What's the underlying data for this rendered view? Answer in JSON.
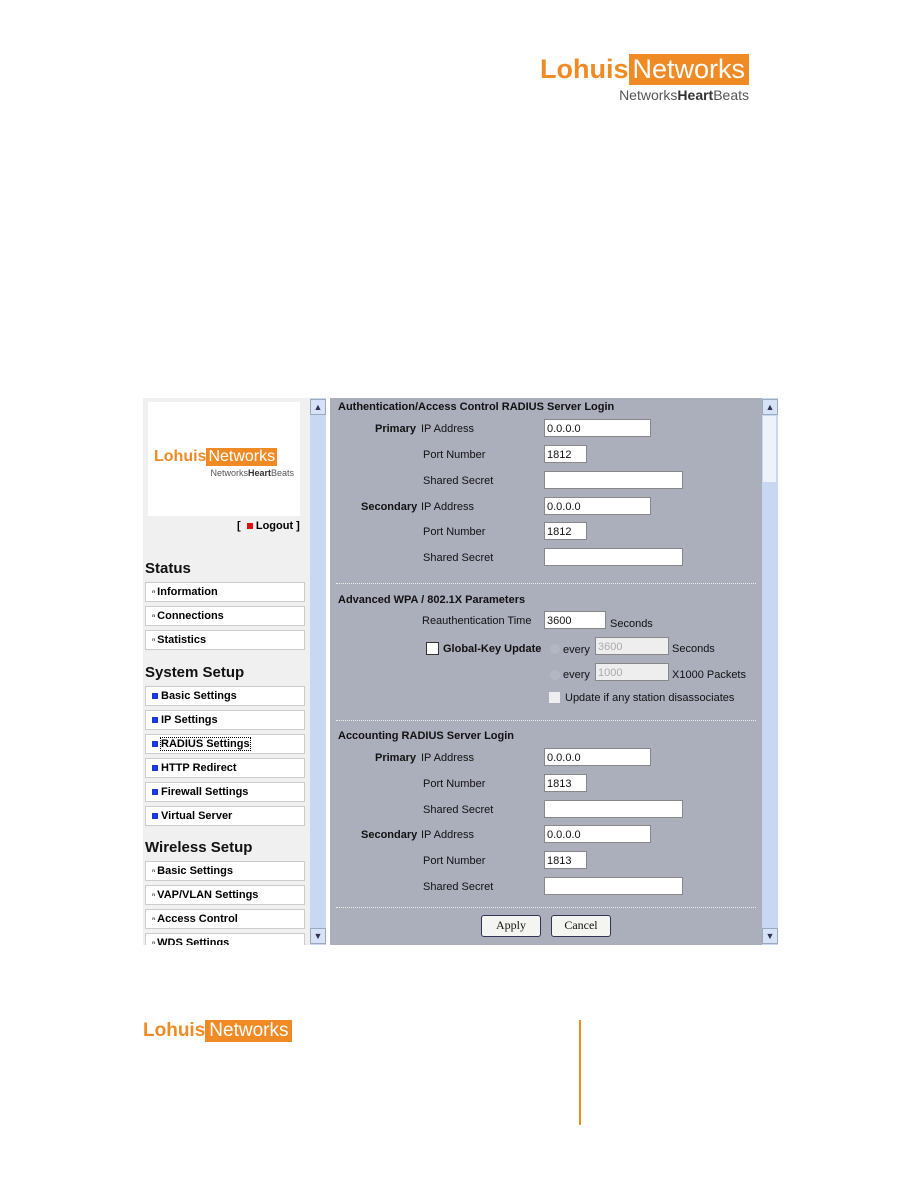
{
  "brand": {
    "name_a": "Lohuis",
    "name_b": "Networks",
    "tagline_a": "Networks",
    "tagline_b": "Heart",
    "tagline_c": "Beats",
    "color": "#f08a24"
  },
  "sidebar": {
    "logout": "Logout",
    "status_title": "Status",
    "status_items": [
      "Information",
      "Connections",
      "Statistics"
    ],
    "system_title": "System Setup",
    "system_items": [
      "Basic Settings",
      "IP Settings",
      "RADIUS Settings",
      "HTTP Redirect",
      "Firewall Settings",
      "Virtual Server"
    ],
    "wireless_title": "Wireless Setup",
    "wireless_items": [
      "Basic Settings",
      "VAP/VLAN Settings",
      "Access Control",
      "WDS Settings"
    ]
  },
  "auth": {
    "title": "Authentication/Access Control RADIUS Server Login",
    "primary": "Primary",
    "secondary": "Secondary",
    "ip_label": "IP Address",
    "port_label": "Port Number",
    "secret_label": "Shared Secret",
    "primary_ip": "0.0.0.0",
    "primary_port": "1812",
    "primary_secret": "",
    "secondary_ip": "0.0.0.0",
    "secondary_port": "1812",
    "secondary_secret": ""
  },
  "wpa": {
    "title": "Advanced WPA / 802.1X Parameters",
    "reauth_label": "Reauthentication Time",
    "reauth_value": "3600",
    "seconds": "Seconds",
    "global_key": "Global-Key Update",
    "global_key_checked": false,
    "every": "every",
    "every_seconds_value": "3600",
    "every_packets_value": "1000",
    "packets_unit": "X1000 Packets",
    "disassoc": "Update if any station disassociates"
  },
  "acct": {
    "title": "Accounting RADIUS Server Login",
    "primary": "Primary",
    "secondary": "Secondary",
    "ip_label": "IP Address",
    "port_label": "Port Number",
    "secret_label": "Shared Secret",
    "primary_ip": "0.0.0.0",
    "primary_port": "1813",
    "primary_secret": "",
    "secondary_ip": "0.0.0.0",
    "secondary_port": "1813",
    "secondary_secret": ""
  },
  "buttons": {
    "apply": "Apply",
    "cancel": "Cancel"
  }
}
